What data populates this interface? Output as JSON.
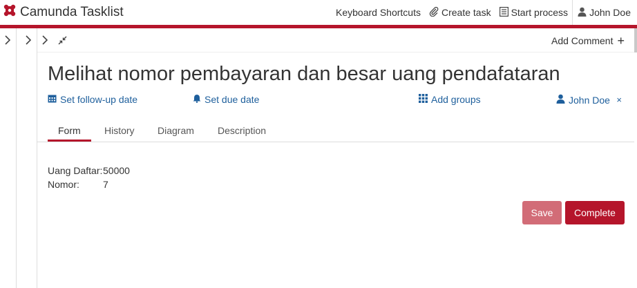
{
  "app": {
    "title": "Camunda Tasklist"
  },
  "topnav": {
    "keyboard_shortcuts": "Keyboard Shortcuts",
    "create_task": "Create task",
    "start_process": "Start process",
    "user": "John Doe"
  },
  "toolbar": {
    "add_comment": "Add Comment",
    "add_icon": "+"
  },
  "task": {
    "title": "Melihat nomor pembayaran dan besar uang pendafataran",
    "follow_up": "Set follow-up date",
    "due_date": "Set due date",
    "groups": "Add groups",
    "assignee": "John Doe",
    "remove_assignee": "×"
  },
  "tabs": [
    {
      "label": "Form",
      "active": true
    },
    {
      "label": "History"
    },
    {
      "label": "Diagram"
    },
    {
      "label": "Description"
    }
  ],
  "form": {
    "fields": [
      {
        "label": "Uang Daftar:",
        "value": "50000"
      },
      {
        "label": "Nomor:",
        "value": "7"
      }
    ],
    "save_label": "Save",
    "complete_label": "Complete"
  },
  "colors": {
    "brand": "#b5152b",
    "link": "#1e5f9c",
    "save": "#d26c77"
  },
  "icons": [
    "camunda-logo-icon",
    "paperclip-icon",
    "list-icon",
    "user-icon",
    "chevron-right-icon",
    "collapse-icon",
    "calendar-icon",
    "bell-icon",
    "grid-icon"
  ]
}
